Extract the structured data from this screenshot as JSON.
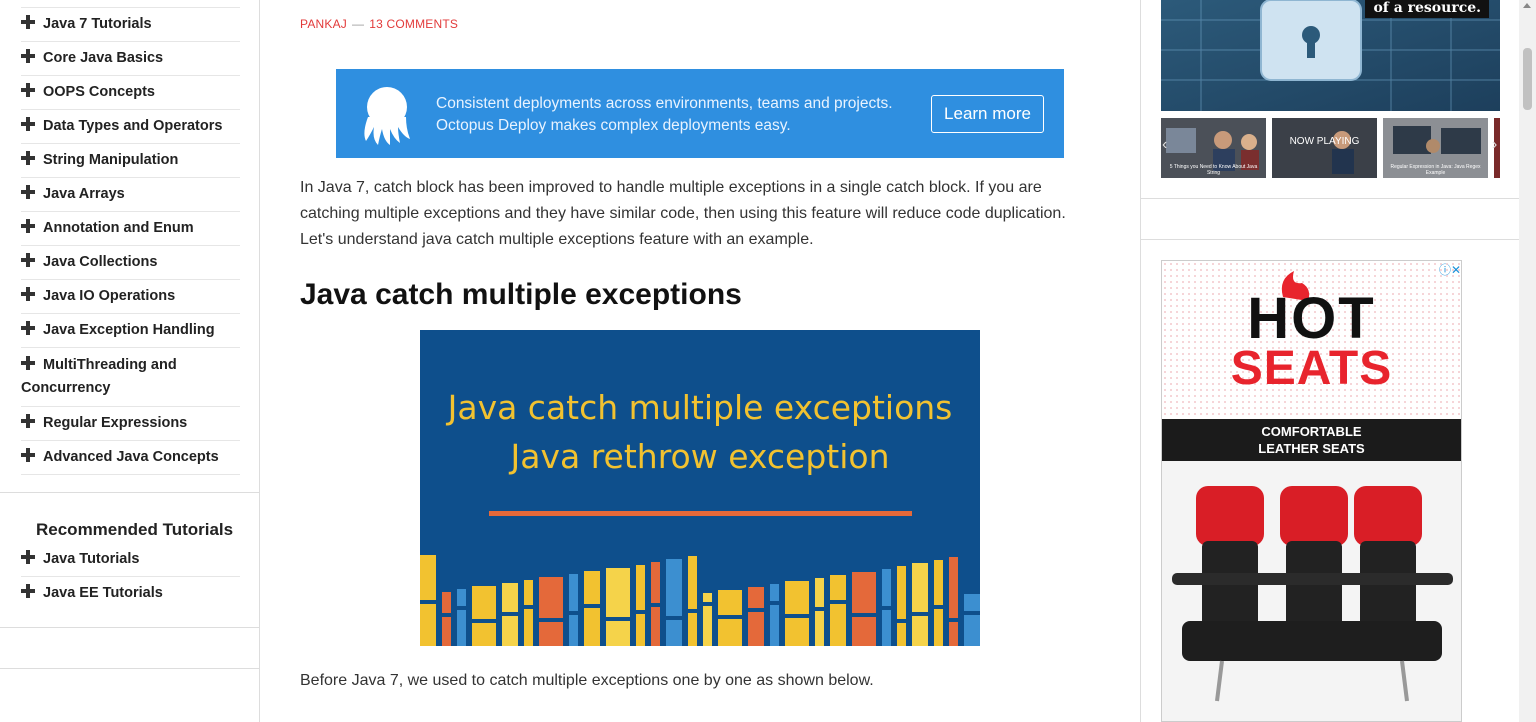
{
  "sidebar": {
    "categories": [
      "Java 7 Tutorials",
      "Core Java Basics",
      "OOPS Concepts",
      "Data Types and Operators",
      "String Manipulation",
      "Java Arrays",
      "Annotation and Enum",
      "Java Collections",
      "Java IO Operations",
      "Java Exception Handling",
      "MultiThreading and Concurrency",
      "Regular Expressions",
      "Advanced Java Concepts"
    ],
    "recommended_title": "Recommended Tutorials",
    "recommended": [
      "Java Tutorials",
      "Java EE Tutorials"
    ]
  },
  "article": {
    "author": "PANKAJ",
    "separator": "—",
    "comments": "13 COMMENTS",
    "intro": "In Java 7, catch block has been improved to handle multiple exceptions in a single catch block. If you are catching multiple exceptions and they have similar code, then using this feature will reduce code duplication. Let's understand java catch multiple exceptions feature with an example.",
    "heading": "Java catch multiple exceptions",
    "feature_line1": "Java catch multiple exceptions",
    "feature_line2": "Java rethrow exception",
    "after_text": "Before Java 7, we used to catch multiple exceptions one by one as shown below."
  },
  "top_ad": {
    "line1": "Consistent deployments across environments, teams and projects.",
    "line2": "Octopus Deploy makes complex deployments easy.",
    "button": "Learn more"
  },
  "right": {
    "hero_tag": "of a resource.",
    "now_playing": "NOW PLAYING",
    "thumb_captions": [
      "5 Things you Need to Know About Java String",
      "Regular Expression in Java: Java Regex Example"
    ],
    "hot": "HOT",
    "seats": "SEATS",
    "band_line1": "COMFORTABLE",
    "band_line2": "LEATHER SEATS",
    "adchoice": "ⓘ✕"
  },
  "colors": {
    "accent_red": "#e23a3a",
    "ad_blue": "#2f8fe0",
    "feature_navy": "#0e4f8c",
    "feature_yellow": "#f2c230"
  }
}
